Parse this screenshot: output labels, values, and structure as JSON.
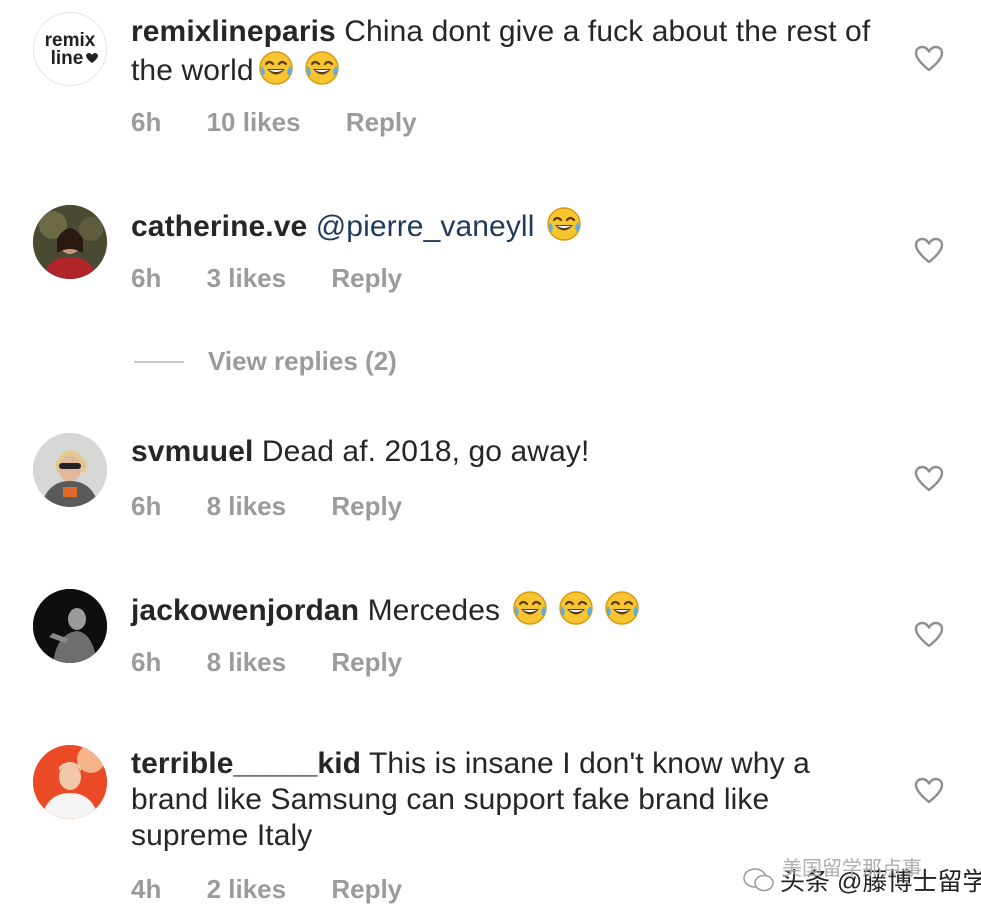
{
  "comments": [
    {
      "username": "remixlineparis",
      "text": "China dont give a fuck about the rest of the world",
      "emoji_count": 2,
      "time": "6h",
      "likes": "10 likes",
      "reply": "Reply",
      "avatar_logo_line1": "remix",
      "avatar_logo_line2": "line"
    },
    {
      "username": "catherine.ve",
      "text": "@pierre_vaneyll",
      "emoji_count": 1,
      "time": "6h",
      "likes": "3 likes",
      "reply": "Reply"
    },
    {
      "username": "svmuuel",
      "text": "Dead af. 2018, go away!",
      "emoji_count": 0,
      "time": "6h",
      "likes": "8 likes",
      "reply": "Reply"
    },
    {
      "username": "jackowenjordan",
      "text": "Mercedes",
      "emoji_count": 3,
      "time": "6h",
      "likes": "8 likes",
      "reply": "Reply"
    },
    {
      "username": "terrible_____kid",
      "text": "This is insane I don't know why a brand like Samsung can support fake brand like supreme Italy",
      "emoji_count": 0,
      "time": "4h",
      "likes": "2 likes",
      "reply": "Reply"
    }
  ],
  "view_replies": "View replies (2)",
  "watermark": {
    "main": "头条 @藤博士留学",
    "faint": "美国留学那点事"
  },
  "icons": {
    "like": "heart-outline-icon",
    "emoji": "face-with-tears-of-joy-icon"
  },
  "colors": {
    "text": "#262626",
    "meta": "#9b9b9b",
    "heart_stroke": "#8e8e8e"
  }
}
